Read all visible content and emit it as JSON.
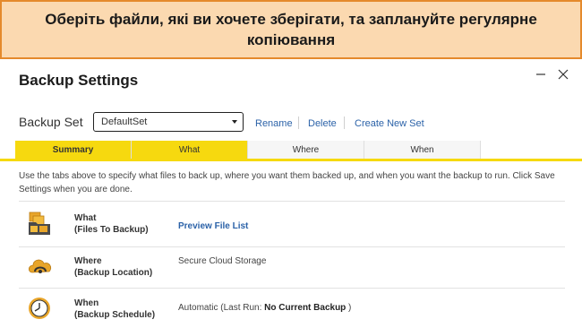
{
  "banner": {
    "text": "Оберіть файли, які ви хочете зберігати, та заплануйте регулярне копіювання"
  },
  "dialog": {
    "title": "Backup Settings",
    "backup_set_label": "Backup Set",
    "backup_set_value": "DefaultSet",
    "actions": {
      "rename": "Rename",
      "delete": "Delete",
      "create": "Create New Set"
    },
    "tabs": [
      "Summary",
      "What",
      "Where",
      "When"
    ],
    "intro": "Use the tabs above to specify what files to back up, where you want them backed up, and when you want the backup to run. Click Save Settings when you are done.",
    "rows": [
      {
        "title": "What",
        "subtitle": "(Files To Backup)",
        "value": "Preview File List",
        "icon": "folder-files-icon"
      },
      {
        "title": "Where",
        "subtitle": "(Backup Location)",
        "value": "Secure Cloud Storage",
        "icon": "cloud-location-icon"
      },
      {
        "title": "When",
        "subtitle": "(Backup Schedule)",
        "value_prefix": "Automatic (Last Run: ",
        "value_strong": "No Current Backup",
        "value_suffix": " )",
        "icon": "clock-icon"
      }
    ]
  },
  "colors": {
    "banner_bg": "#fbd9b0",
    "banner_border": "#e58a2c",
    "tab_active": "#f6d90f",
    "link": "#2b62a8"
  }
}
